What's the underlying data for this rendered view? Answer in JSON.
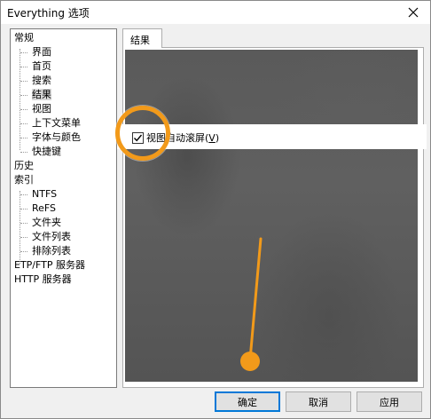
{
  "window": {
    "title": "Everything 选项"
  },
  "tree": {
    "items": [
      {
        "label": "常规",
        "level": 0
      },
      {
        "label": "界面",
        "level": 1
      },
      {
        "label": "首页",
        "level": 1
      },
      {
        "label": "搜索",
        "level": 1
      },
      {
        "label": "结果",
        "level": 1,
        "selected": true
      },
      {
        "label": "视图",
        "level": 1
      },
      {
        "label": "上下文菜单",
        "level": 1
      },
      {
        "label": "字体与颜色",
        "level": 1
      },
      {
        "label": "快捷键",
        "level": 1
      },
      {
        "label": "历史",
        "level": 0
      },
      {
        "label": "索引",
        "level": 0
      },
      {
        "label": "NTFS",
        "level": 1
      },
      {
        "label": "ReFS",
        "level": 1
      },
      {
        "label": "文件夹",
        "level": 1
      },
      {
        "label": "文件列表",
        "level": 1
      },
      {
        "label": "排除列表",
        "level": 1
      },
      {
        "label": "ETP/FTP 服务器",
        "level": 0
      },
      {
        "label": "HTTP 服务器",
        "level": 0
      }
    ]
  },
  "tab": {
    "label": "结果"
  },
  "option": {
    "label_pre": "视图自动滚屏(",
    "label_key": "V",
    "label_post": ")",
    "checked": true
  },
  "buttons": {
    "ok": "确定",
    "cancel": "取消",
    "apply": "应用"
  },
  "colors": {
    "annotation": "#f29a1a",
    "default_button_border": "#0078d7",
    "overlay": "#5a5a5a"
  },
  "icons": {
    "close": "close-icon",
    "check": "checkmark-icon"
  }
}
